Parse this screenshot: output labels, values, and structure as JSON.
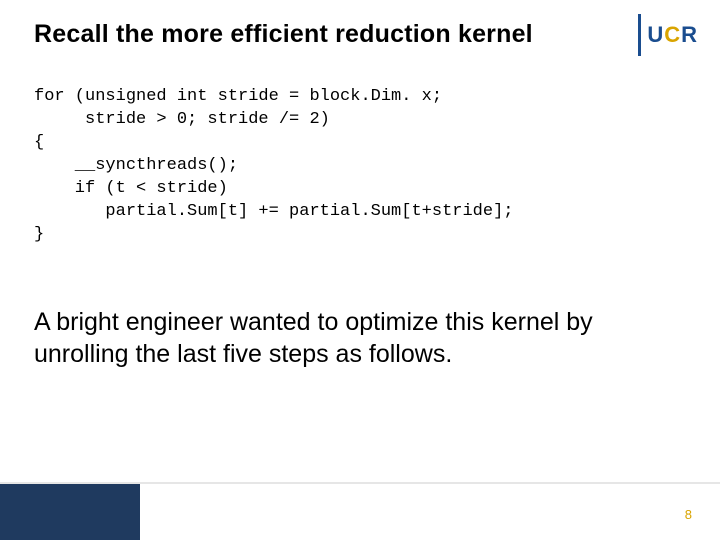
{
  "title": "Recall the more efficient reduction kernel",
  "logo": {
    "u": "U",
    "c": "C",
    "r": "R"
  },
  "code": {
    "l1": "for (unsigned int stride = block.Dim. x;",
    "l2": "     stride > 0; stride /= 2)",
    "l3": "{",
    "l4": "    __syncthreads();",
    "l5": "    if (t < stride)",
    "l6": "       partial.Sum[t] += partial.Sum[t+stride];",
    "l7": "}"
  },
  "body": "A bright engineer wanted to optimize this kernel by unrolling the last five steps as follows.",
  "page_number": "8"
}
